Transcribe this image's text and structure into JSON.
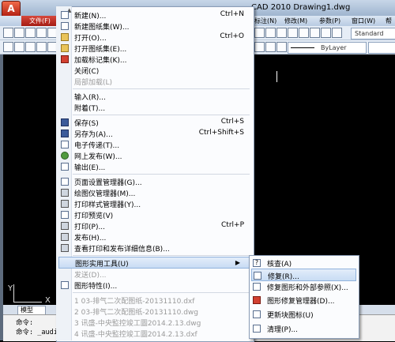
{
  "titlebar": {
    "app_button": "A",
    "title": "CAD 2010     Drawing1.dwg"
  },
  "ribbon": {
    "file_tab": "文件(F)",
    "dimension": "标注(N)",
    "modify": "修改(M)",
    "params": "参数(P)",
    "window": "窗口(W)",
    "help": "帮"
  },
  "toolbar": {
    "text_style": "Standard",
    "linetype": "ByLayer"
  },
  "file_menu": {
    "items": [
      {
        "label": "新建(N)...",
        "shortcut": "Ctrl+N"
      },
      {
        "label": "新建图纸集(W)...",
        "shortcut": ""
      },
      {
        "label": "打开(O)...",
        "shortcut": "Ctrl+O"
      },
      {
        "label": "打开图纸集(E)...",
        "shortcut": ""
      },
      {
        "label": "加载标记集(K)...",
        "shortcut": ""
      },
      {
        "label": "关闭(C)",
        "shortcut": ""
      },
      {
        "label": "局部加载(L)",
        "shortcut": ""
      },
      {
        "label": "输入(R)...",
        "shortcut": ""
      },
      {
        "label": "附着(T)...",
        "shortcut": ""
      },
      {
        "label": "保存(S)",
        "shortcut": "Ctrl+S"
      },
      {
        "label": "另存为(A)...",
        "shortcut": "Ctrl+Shift+S"
      },
      {
        "label": "电子传递(T)...",
        "shortcut": ""
      },
      {
        "label": "网上发布(W)...",
        "shortcut": ""
      },
      {
        "label": "输出(E)...",
        "shortcut": ""
      },
      {
        "label": "页面设置管理器(G)...",
        "shortcut": ""
      },
      {
        "label": "绘图仪管理器(M)...",
        "shortcut": ""
      },
      {
        "label": "打印样式管理器(Y)...",
        "shortcut": ""
      },
      {
        "label": "打印预览(V)",
        "shortcut": ""
      },
      {
        "label": "打印(P)...",
        "shortcut": "Ctrl+P"
      },
      {
        "label": "发布(H)...",
        "shortcut": ""
      },
      {
        "label": "查看打印和发布详细信息(B)...",
        "shortcut": ""
      },
      {
        "label": "图形实用工具(U)",
        "shortcut": ""
      },
      {
        "label": "发送(D)...",
        "shortcut": ""
      },
      {
        "label": "图形特性(I)...",
        "shortcut": ""
      },
      {
        "label": "1 03-排气二次配图纸-20131110.dxf",
        "shortcut": ""
      },
      {
        "label": "2 03-排气二次配图纸-20131110.dwg",
        "shortcut": ""
      },
      {
        "label": "3 讯盛-中央監控竣工圖2014.2.13.dwg",
        "shortcut": ""
      },
      {
        "label": "4 讯盛-中央監控竣工圖2014.2.13.dxf",
        "shortcut": ""
      }
    ]
  },
  "submenu": {
    "items": [
      {
        "label": "核查(A)"
      },
      {
        "label": "修复(R)..."
      },
      {
        "label": "修复图形和外部参照(X)..."
      },
      {
        "label": "图形修复管理器(D)..."
      },
      {
        "label": "更新块图标(U)"
      },
      {
        "label": "清理(P)..."
      }
    ]
  },
  "ucs": {
    "x": "X",
    "y": "Y"
  },
  "tabs": {
    "model": "模型"
  },
  "command": {
    "line1": "命令:",
    "line2": "命令: _audit"
  },
  "colors": {
    "highlight": "#c8dcf4",
    "file_tab": "#c0392b"
  }
}
